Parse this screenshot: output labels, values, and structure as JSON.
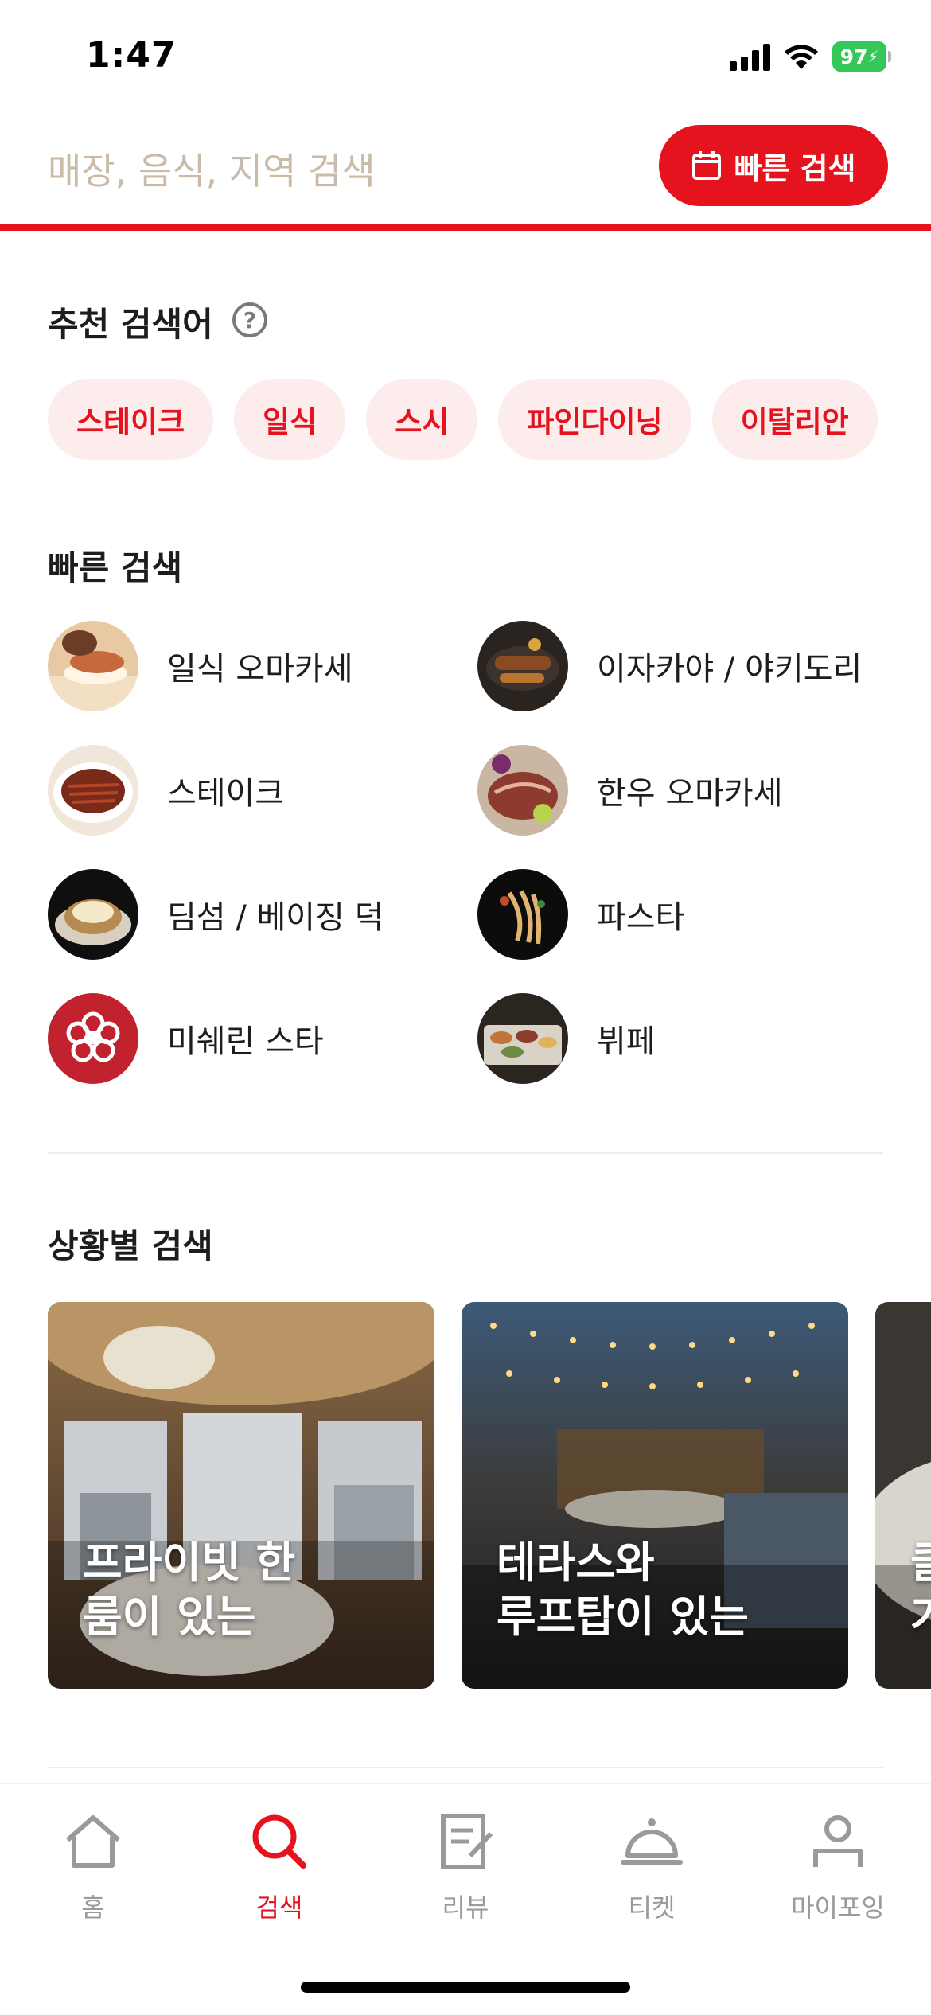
{
  "status_bar": {
    "time": "1:47",
    "battery": "97"
  },
  "search": {
    "placeholder": "매장, 음식, 지역 검색",
    "quick_search_button": "빠른 검색"
  },
  "recommended": {
    "title": "추천 검색어",
    "help_icon": "question-circle-icon",
    "keywords": [
      "스테이크",
      "일식",
      "스시",
      "파인다이닝",
      "이탈리안"
    ]
  },
  "quick_search": {
    "title": "빠른 검색",
    "items": [
      {
        "label": "일식 오마카세",
        "icon": "sushi-thumbnail"
      },
      {
        "label": "이자카야 / 야키도리",
        "icon": "yakitori-thumbnail"
      },
      {
        "label": "스테이크",
        "icon": "steak-thumbnail"
      },
      {
        "label": "한우 오마카세",
        "icon": "hanwoo-thumbnail"
      },
      {
        "label": "딤섬 / 베이징 덕",
        "icon": "dimsum-thumbnail"
      },
      {
        "label": "파스타",
        "icon": "pasta-thumbnail"
      },
      {
        "label": "미쉐린 스타",
        "icon": "michelin-star-icon"
      },
      {
        "label": "뷔페",
        "icon": "buffet-thumbnail"
      }
    ]
  },
  "situation_search": {
    "title": "상황별 검색",
    "cards": [
      {
        "label": "프라이빗 한\n룸이 있는"
      },
      {
        "label": "테라스와\n루프탑이 있는"
      },
      {
        "label": "클\n가"
      }
    ]
  },
  "bottom_nav": {
    "items": [
      {
        "label": "홈",
        "icon": "home-icon",
        "active": false
      },
      {
        "label": "검색",
        "icon": "search-icon",
        "active": true
      },
      {
        "label": "리뷰",
        "icon": "review-icon",
        "active": false
      },
      {
        "label": "티켓",
        "icon": "ticket-cloche-icon",
        "active": false
      },
      {
        "label": "마이포잉",
        "icon": "profile-icon",
        "active": false
      }
    ]
  },
  "colors": {
    "accent": "#e5131d",
    "chip_bg": "#fdecec",
    "placeholder": "#c9bba8"
  }
}
